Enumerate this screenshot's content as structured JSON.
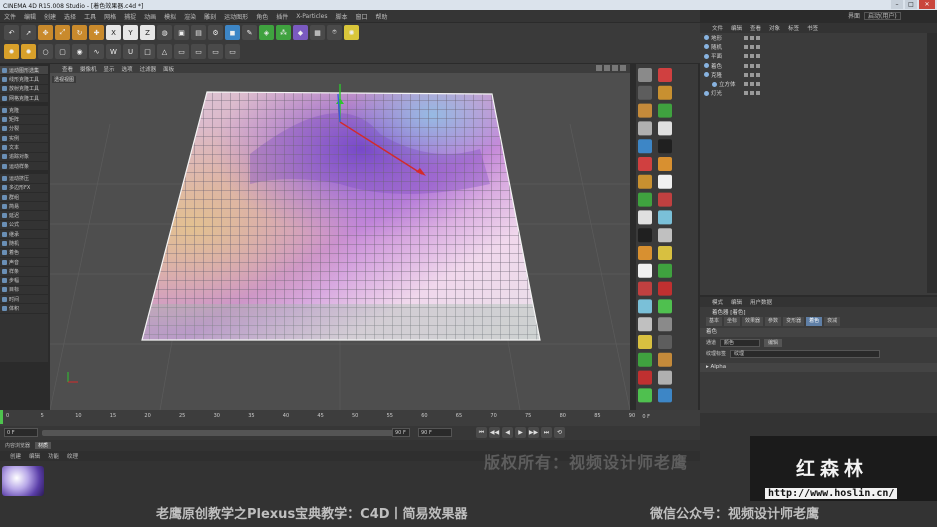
{
  "window": {
    "title": "CINEMA 4D R15.008 Studio - [着色效果器.c4d *]"
  },
  "menubar": [
    "文件",
    "编辑",
    "创建",
    "选择",
    "工具",
    "网格",
    "捕捉",
    "动画",
    "模拟",
    "渲染",
    "雕刻",
    "运动图形",
    "角色",
    "插件",
    "X-Particles",
    "脚本",
    "窗口",
    "帮助"
  ],
  "layout": {
    "label": "界面",
    "value": "启动(用户)"
  },
  "toolbar": {
    "row1": [
      "undo",
      "cursor",
      "move",
      "scale",
      "rotate",
      "add",
      "X",
      "Y",
      "Z",
      "world",
      "render-view",
      "render-active",
      "render-settings",
      "cube",
      "pen",
      "subdivision",
      "array",
      "deformer",
      "scene",
      "camera",
      "light"
    ],
    "row2": [
      "gear",
      "gear",
      "circle",
      "cube-sel",
      "sphere-sel",
      "wave",
      "W",
      "U",
      "box",
      "cone",
      "view1",
      "view2",
      "view3",
      "view4"
    ]
  },
  "side_panel": {
    "items": [
      {
        "label": "运动图形选集",
        "sel": true
      },
      {
        "label": "线形克隆工具"
      },
      {
        "label": "放射克隆工具"
      },
      {
        "label": "网格克隆工具"
      },
      {
        "label": "",
        "sep": true
      },
      {
        "label": "克隆"
      },
      {
        "label": "矩阵"
      },
      {
        "label": "分裂"
      },
      {
        "label": "实例"
      },
      {
        "label": "文本"
      },
      {
        "label": "追踪对象"
      },
      {
        "label": "运动样条"
      },
      {
        "label": "",
        "sep": true
      },
      {
        "label": "运动挤压"
      },
      {
        "label": "多边形FX"
      },
      {
        "label": "群组"
      },
      {
        "label": "简易"
      },
      {
        "label": "延迟"
      },
      {
        "label": "公式"
      },
      {
        "label": "继承"
      },
      {
        "label": "随机"
      },
      {
        "label": "着色"
      },
      {
        "label": "声音"
      },
      {
        "label": "样条"
      },
      {
        "label": "步幅"
      },
      {
        "label": "目标"
      },
      {
        "label": "时间"
      },
      {
        "label": "体积"
      }
    ]
  },
  "viewport": {
    "menu": [
      "查看",
      "摄像机",
      "显示",
      "选项",
      "过滤器",
      "面板"
    ],
    "label": "透视视图",
    "axis_labels": {
      "x": "x",
      "y": "y",
      "z": "z"
    }
  },
  "object_manager": {
    "menu": [
      "文件",
      "编辑",
      "查看",
      "对象",
      "标签",
      "书签"
    ],
    "items": [
      {
        "label": "地形",
        "indent": 0
      },
      {
        "label": "随机",
        "indent": 0
      },
      {
        "label": "平面",
        "indent": 0
      },
      {
        "label": "着色",
        "indent": 0
      },
      {
        "label": "克隆",
        "indent": 0
      },
      {
        "label": "立方体",
        "indent": 1
      },
      {
        "label": "灯光",
        "indent": 0
      }
    ]
  },
  "attribute_manager": {
    "menu": [
      "模式",
      "编辑",
      "用户数据"
    ],
    "title": "着色器 [着色]",
    "tabs": [
      "基本",
      "坐标",
      "效果器",
      "参数",
      "变形器",
      "着色",
      "衰减"
    ],
    "active_tab": "着色",
    "section": "着色",
    "channel_label": "通道",
    "channel_value": "颜色",
    "edit_button": "编辑",
    "texture_label": "纹理标签",
    "texture_value": "纹理",
    "alpha_section": "▸ Alpha"
  },
  "timeline": {
    "ticks": [
      "0",
      "5",
      "10",
      "15",
      "20",
      "25",
      "30",
      "35",
      "40",
      "45",
      "50",
      "55",
      "60",
      "65",
      "70",
      "75",
      "80",
      "85",
      "90"
    ],
    "end_label": "0 F",
    "start_frame": "0 F",
    "current_field": "0 F",
    "end_field": "90 F",
    "end_field2": "90 F"
  },
  "transport": {
    "buttons": [
      "⏮",
      "◀◀",
      "◀",
      "▶",
      "▶▶",
      "⏭",
      "⟲"
    ]
  },
  "material_manager": {
    "tabs": [
      "内容浏览器",
      "材质"
    ],
    "active_tab": "材质",
    "menu": [
      "创建",
      "编辑",
      "功能",
      "纹理"
    ]
  },
  "overlay": {
    "watermark": "版权所有：视频设计师老鹰",
    "caption_left": "老鹰原创教学之Plexus宝典教学：C4D丨简易效果器",
    "caption_right": "微信公众号：视频设计师老鹰",
    "logo_title": "红森林",
    "logo_url": "http://www.hoslin.cn/"
  }
}
